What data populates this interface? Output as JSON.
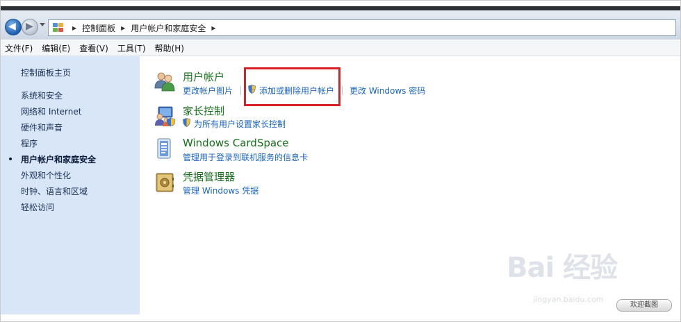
{
  "breadcrumb": {
    "items": [
      "控制面板",
      "用户帐户和家庭安全"
    ]
  },
  "menu": {
    "items": [
      "文件(F)",
      "编辑(E)",
      "查看(V)",
      "工具(T)",
      "帮助(H)"
    ]
  },
  "sidebar": {
    "items": [
      {
        "label": "控制面板主页",
        "current": false
      },
      {
        "label": "系统和安全",
        "current": false
      },
      {
        "label": "网络和 Internet",
        "current": false
      },
      {
        "label": "硬件和声音",
        "current": false
      },
      {
        "label": "程序",
        "current": false
      },
      {
        "label": "用户帐户和家庭安全",
        "current": true
      },
      {
        "label": "外观和个性化",
        "current": false
      },
      {
        "label": "时钟、语言和区域",
        "current": false
      },
      {
        "label": "轻松访问",
        "current": false
      }
    ]
  },
  "categories": {
    "user_accounts": {
      "title": "用户帐户",
      "tasks": [
        "更改帐户图片",
        "添加或删除用户帐户",
        "更改 Windows 密码"
      ],
      "icon": "users-icon"
    },
    "parental_controls": {
      "title": "家长控制",
      "tasks": [
        "为所有用户设置家长控制"
      ],
      "icon": "family-icon"
    },
    "cardspace": {
      "title": "Windows CardSpace",
      "tasks": [
        "管理用于登录到联机服务的信息卡"
      ],
      "icon": "card-icon"
    },
    "credential_manager": {
      "title": "凭据管理器",
      "tasks": [
        "管理 Windows 凭据"
      ],
      "icon": "vault-icon"
    }
  },
  "watermark": {
    "logo": "Bai 经验",
    "url": "jingyan.baidu.com",
    "snip_label": "欢迎截图"
  },
  "colors": {
    "title_green": "#1a6d1e",
    "link_blue": "#1d64b8",
    "sidebar_bg": "#d8e6f7",
    "highlight_red": "#d81f26"
  }
}
